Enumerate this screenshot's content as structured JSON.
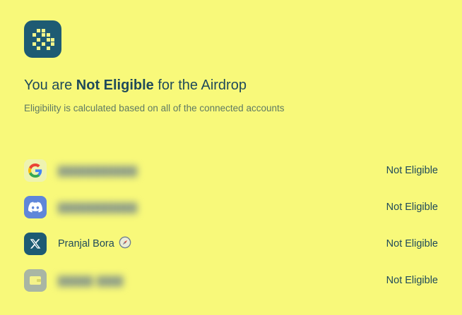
{
  "header": {
    "title_prefix": "You are ",
    "title_strong": "Not Eligible",
    "title_suffix": " for the Airdrop",
    "subtitle": "Eligibility is calculated based on all of the connected accounts"
  },
  "accounts": [
    {
      "icon": "google-icon",
      "name": "",
      "name_hidden": true,
      "status": "Not Eligible"
    },
    {
      "icon": "discord-icon",
      "name": "",
      "name_hidden": true,
      "status": "Not Eligible"
    },
    {
      "icon": "x-icon",
      "name": "Pranjal Bora",
      "name_hidden": false,
      "badge_icon": "compass-icon",
      "status": "Not Eligible"
    },
    {
      "icon": "wallet-icon",
      "name": "",
      "name_hidden": true,
      "status": "Not Eligible"
    }
  ],
  "colors": {
    "background": "#f8f97a",
    "brand": "#1e5b73",
    "text": "#1f4a5a",
    "subtitle": "#5f7a63",
    "discord": "#5f86d9"
  }
}
